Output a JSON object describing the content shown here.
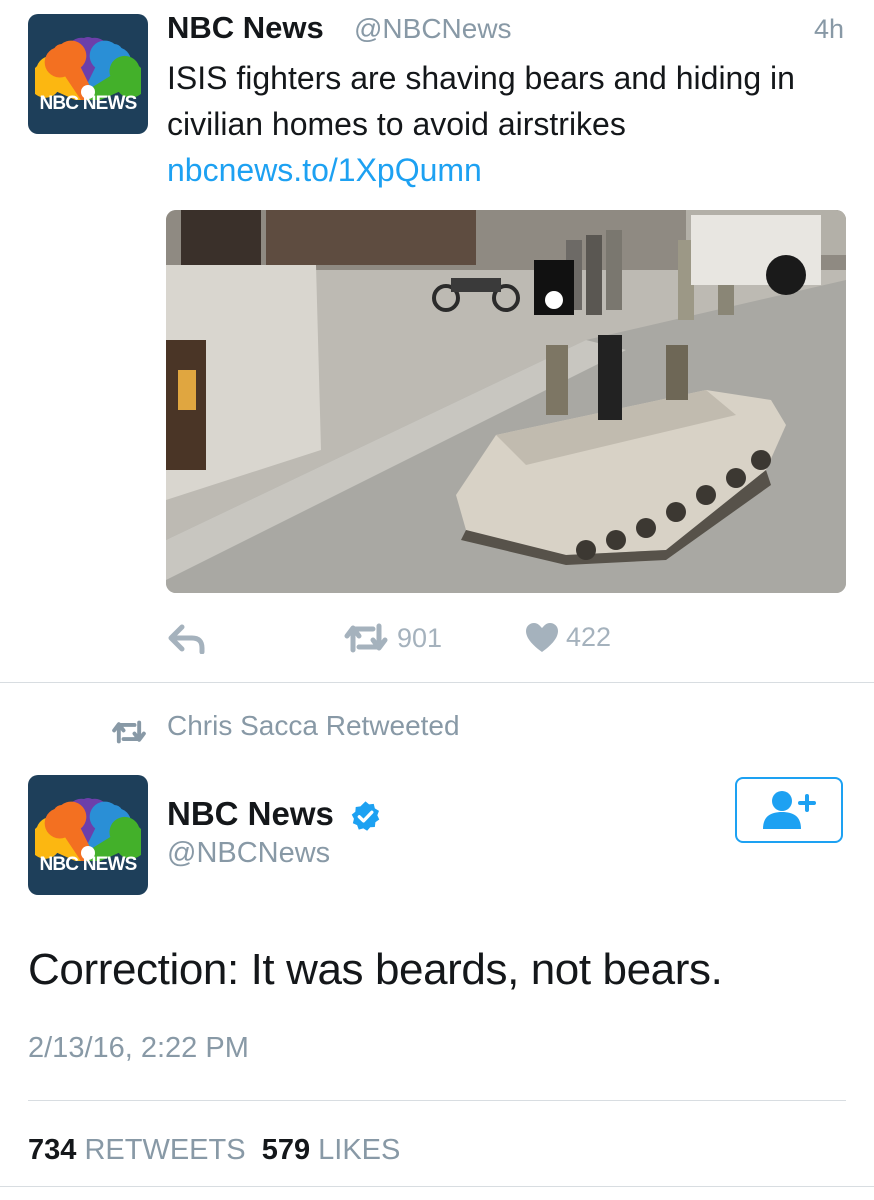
{
  "tweet1": {
    "logo_text": "NBC NEWS",
    "name": "NBC News",
    "handle": "@NBCNews",
    "time": "4h",
    "text": "ISIS fighters are shaving bears and hiding in civilian homes to avoid airstrikes ",
    "link": "nbcnews.to/1XpQumn",
    "retweets": "901",
    "likes": "422"
  },
  "retweet_context": {
    "label": "Chris Sacca Retweeted"
  },
  "tweet2": {
    "logo_text": "NBC NEWS",
    "name": "NBC News",
    "handle": "@NBCNews",
    "text": "Correction: It was beards, not bears.",
    "date": "2/13/16, 2:22 PM",
    "retweet_count": "734",
    "retweet_label": "RETWEETS",
    "like_count": "579",
    "like_label": "LIKES"
  },
  "icons": {
    "reply": "reply-icon",
    "retweet": "retweet-icon",
    "like": "heart-icon",
    "verified": "verified-badge-icon",
    "follow": "follow-user-icon",
    "logo": "nbc-peacock-logo"
  },
  "colors": {
    "accent": "#1da1f2",
    "muted": "#8899a6",
    "icon_muted": "#a5b2bd",
    "avatar_bg": "#1e3f5a"
  }
}
